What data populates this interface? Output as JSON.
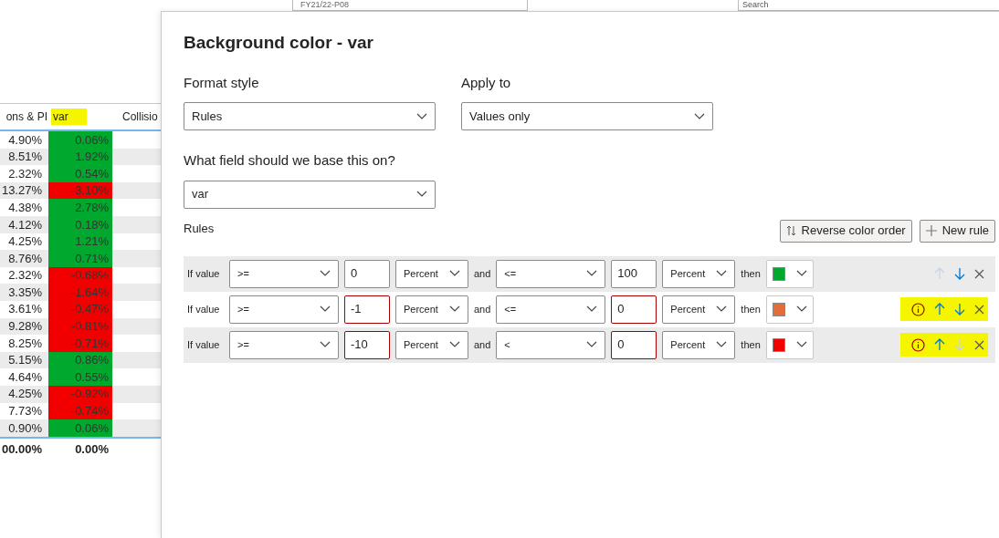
{
  "background_app": {
    "period_dropdown": "FY21/22-P08",
    "search": {
      "placeholder": "Search"
    }
  },
  "table": {
    "columns": [
      {
        "label": "ons & PI",
        "highlighted": false
      },
      {
        "label": "var",
        "highlighted": true
      },
      {
        "label": "Collisio",
        "highlighted": false
      }
    ],
    "rows": [
      {
        "value": "4.90%",
        "var": "0.06%",
        "color": "#00a82d"
      },
      {
        "value": "8.51%",
        "var": "1.92%",
        "color": "#00a82d"
      },
      {
        "value": "2.32%",
        "var": "0.54%",
        "color": "#00a82d"
      },
      {
        "value": "13.27%",
        "var": "-3.10%",
        "color": "#f20000"
      },
      {
        "value": "4.38%",
        "var": "2.78%",
        "color": "#00a82d"
      },
      {
        "value": "4.12%",
        "var": "0.18%",
        "color": "#00a82d"
      },
      {
        "value": "4.25%",
        "var": "1.21%",
        "color": "#00a82d"
      },
      {
        "value": "8.76%",
        "var": "0.71%",
        "color": "#00a82d"
      },
      {
        "value": "2.32%",
        "var": "-0.68%",
        "color": "#f20000"
      },
      {
        "value": "3.35%",
        "var": "-1.64%",
        "color": "#f20000"
      },
      {
        "value": "3.61%",
        "var": "-0.47%",
        "color": "#f20000"
      },
      {
        "value": "9.28%",
        "var": "-0.81%",
        "color": "#f20000"
      },
      {
        "value": "8.25%",
        "var": "-0.71%",
        "color": "#f20000"
      },
      {
        "value": "5.15%",
        "var": "0.86%",
        "color": "#00a82d"
      },
      {
        "value": "4.64%",
        "var": "0.55%",
        "color": "#00a82d"
      },
      {
        "value": "4.25%",
        "var": "-0.92%",
        "color": "#f20000"
      },
      {
        "value": "7.73%",
        "var": "-0.74%",
        "color": "#f20000"
      },
      {
        "value": "0.90%",
        "var": "0.06%",
        "color": "#00a82d"
      }
    ],
    "totals": [
      "00.00%",
      "0.00%"
    ]
  },
  "dialog": {
    "title": "Background color - var",
    "format_style": {
      "label": "Format style",
      "value": "Rules"
    },
    "apply_to": {
      "label": "Apply to",
      "value": "Values only"
    },
    "base_field": {
      "label": "What field should we base this on?",
      "value": "var"
    },
    "rules_label": "Rules",
    "buttons": [
      {
        "kind": "reverse",
        "label": "Reverse color order"
      },
      {
        "kind": "add",
        "label": "New rule"
      }
    ],
    "rules": [
      {
        "if_label": "If value",
        "op1": ">=",
        "min": "0",
        "min_invalid": false,
        "unit1": "Percent",
        "and_label": "and",
        "op2": "<=",
        "max": "100",
        "max_invalid": false,
        "unit2": "Percent",
        "then_label": "then",
        "color": "#00a82d",
        "warning": false,
        "up_disabled": true,
        "down_disabled": false,
        "highlighted": false
      },
      {
        "if_label": "If value",
        "op1": ">=",
        "min": "-1",
        "min_invalid": true,
        "unit1": "Percent",
        "and_label": "and",
        "op2": "<=",
        "max": "0",
        "max_invalid": true,
        "unit2": "Percent",
        "then_label": "then",
        "color": "#e46c3a",
        "warning": true,
        "up_disabled": false,
        "down_disabled": false,
        "highlighted": true
      },
      {
        "if_label": "If value",
        "op1": ">=",
        "min": "-10",
        "min_invalid": true,
        "unit1": "Percent",
        "and_label": "and",
        "op2": "<",
        "max": "0",
        "max_invalid": true,
        "unit2": "Percent",
        "then_label": "then",
        "color": "#f20000",
        "warning": true,
        "up_disabled": false,
        "down_disabled": true,
        "highlighted": true
      }
    ]
  }
}
